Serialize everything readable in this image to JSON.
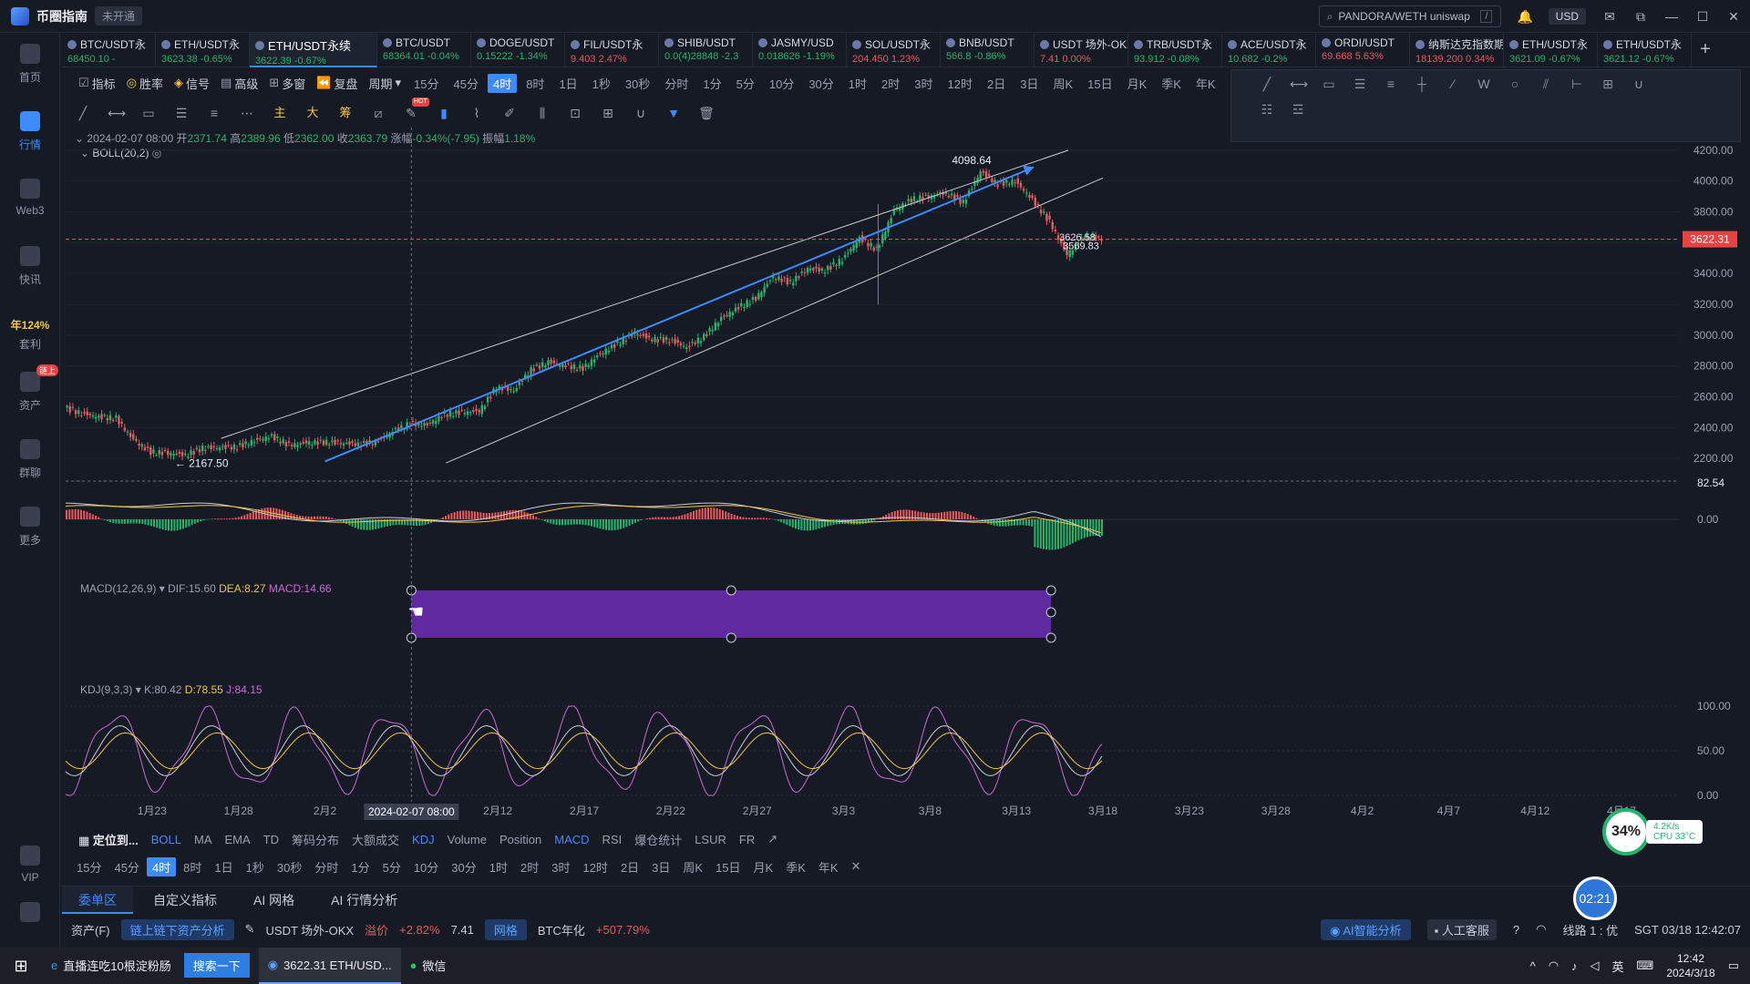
{
  "app": {
    "name": "币圈指南",
    "status": "未开通"
  },
  "titlebar": {
    "search_value": "PANDORA/WETH uniswap",
    "search_key": "/",
    "currency": "USD"
  },
  "sidebar": [
    {
      "label": "首页",
      "icon": "home-icon"
    },
    {
      "label": "行情",
      "icon": "chart-icon"
    },
    {
      "label": "Web3",
      "icon": "web3-icon"
    },
    {
      "label": "快讯",
      "icon": "news-icon"
    },
    {
      "pct": "年124%",
      "label": "套利",
      "icon": "arbitrage-icon"
    },
    {
      "label": "资产",
      "icon": "wallet-icon",
      "badge": "链上"
    },
    {
      "label": "群聊",
      "icon": "chat-icon"
    },
    {
      "label": "更多",
      "icon": "grid-icon"
    },
    {
      "label": "VIP",
      "icon": "vip-icon"
    },
    {
      "label": "",
      "icon": "settings-icon"
    }
  ],
  "tabs": [
    {
      "name": "BTC/USDT永",
      "sub": "68450.10 -",
      "dir": "down"
    },
    {
      "name": "ETH/USDT永",
      "sub": "3623.38 -0.65%",
      "dir": "down"
    },
    {
      "name": "ETH/USDT永续",
      "sub": "3622.39 -0.67%",
      "dir": "down",
      "active": true
    },
    {
      "name": "BTC/USDT",
      "sub": "68364.01 -0.04%",
      "dir": "down"
    },
    {
      "name": "DOGE/USDT",
      "sub": "0.15222 -1.34%",
      "dir": "down"
    },
    {
      "name": "FIL/USDT永",
      "sub": "9.403 2.47%",
      "dir": "up"
    },
    {
      "name": "SHIB/USDT",
      "sub": "0.0(4)28848 -2.3",
      "dir": "down"
    },
    {
      "name": "JASMY/USD",
      "sub": "0.018626 -1.19%",
      "dir": "down"
    },
    {
      "name": "SOL/USDT永",
      "sub": "204.450 1.23%",
      "dir": "up"
    },
    {
      "name": "BNB/USDT",
      "sub": "566.8 -0.86%",
      "dir": "down"
    },
    {
      "name": "USDT 场外-OKX",
      "sub": "7.41 0.00%",
      "dir": "up"
    },
    {
      "name": "TRB/USDT永",
      "sub": "93.912 -0.08%",
      "dir": "down"
    },
    {
      "name": "ACE/USDT永",
      "sub": "10.682 -0.2%",
      "dir": "down"
    },
    {
      "name": "ORDI/USDT",
      "sub": "69.668 5.63%",
      "dir": "up"
    },
    {
      "name": "纳斯达克指数期",
      "sub": "18139.200 0.34%",
      "dir": "up"
    },
    {
      "name": "ETH/USDT永",
      "sub": "3621.09 -0.67%",
      "dir": "down"
    },
    {
      "name": "ETH/USDT永",
      "sub": "3621.12 -0.67%",
      "dir": "down"
    }
  ],
  "toolbar1": {
    "items": [
      "指标",
      "胜率",
      "信号",
      "高级",
      "多窗",
      "复盘",
      "周期"
    ],
    "periods": [
      "15分",
      "45分",
      "4时",
      "8时",
      "1日",
      "1秒",
      "30秒",
      "分时",
      "1分",
      "5分",
      "10分",
      "30分",
      "1时",
      "2时",
      "3时",
      "12时",
      "2日",
      "3日",
      "周K",
      "15日",
      "月K",
      "季K",
      "年K"
    ],
    "active_period": "4时"
  },
  "toolbar2": {
    "gold_labels": [
      "主",
      "大",
      "筹"
    ],
    "hot": "HOT"
  },
  "ohlc": {
    "date": "2024-02-07 08:00",
    "open_label": "开",
    "open": "2371.74",
    "high_label": "高",
    "high": "2389.96",
    "low_label": "低",
    "low": "2362.00",
    "close_label": "收",
    "close": "2363.79",
    "chg_label": "涨幅",
    "chg": "-0.34%(-7.95)",
    "amp_label": "振幅",
    "amp": "1.18%"
  },
  "boll": "BOLL(20,2)",
  "macd": {
    "name": "MACD(12,26,9)",
    "dif": "DIF:15.60",
    "dea": "DEA:8.27",
    "macd": "MACD:14.66"
  },
  "kdj": {
    "name": "KDJ(9,3,3)",
    "k": "K:80.42",
    "d": "D:78.55",
    "j": "J:84.15"
  },
  "chart_data": {
    "type": "candlestick",
    "symbol": "ETH/USDT永续",
    "interval": "4时",
    "y_ticks": [
      4200,
      4000,
      3800,
      3600,
      3400,
      3200,
      3000,
      2800,
      2600,
      2400,
      2200
    ],
    "ylim": [
      2100,
      4300
    ],
    "x_ticks": [
      "1月23",
      "1月28",
      "2月2",
      "2月7",
      "2月12",
      "2月17",
      "2月22",
      "2月27",
      "3月3",
      "3月8",
      "3月13",
      "3月18",
      "3月23",
      "3月28",
      "4月2",
      "4月7",
      "4月12",
      "4月17"
    ],
    "xlim_dates": [
      "2024-01-18",
      "2024-04-20"
    ],
    "crosshair_date": "2024-02-07 08:00",
    "current_price": "3622.31",
    "annotations": {
      "high": "4098.64",
      "low": "2167.50",
      "mark1": "3626.58",
      "mark2": "3569.83"
    },
    "series": [
      {
        "date": "01-18",
        "close": 2530
      },
      {
        "date": "01-19",
        "close": 2490
      },
      {
        "date": "01-20",
        "close": 2470
      },
      {
        "date": "01-21",
        "close": 2460
      },
      {
        "date": "01-22",
        "close": 2320
      },
      {
        "date": "01-23",
        "close": 2240
      },
      {
        "date": "01-24",
        "close": 2235
      },
      {
        "date": "01-25",
        "close": 2220
      },
      {
        "date": "01-26",
        "close": 2265
      },
      {
        "date": "01-27",
        "close": 2270
      },
      {
        "date": "01-28",
        "close": 2275
      },
      {
        "date": "01-29",
        "close": 2315
      },
      {
        "date": "01-30",
        "close": 2345
      },
      {
        "date": "01-31",
        "close": 2285
      },
      {
        "date": "02-01",
        "close": 2300
      },
      {
        "date": "02-02",
        "close": 2305
      },
      {
        "date": "02-03",
        "close": 2300
      },
      {
        "date": "02-04",
        "close": 2290
      },
      {
        "date": "02-05",
        "close": 2305
      },
      {
        "date": "02-06",
        "close": 2375
      },
      {
        "date": "02-07",
        "close": 2425
      },
      {
        "date": "02-08",
        "close": 2420
      },
      {
        "date": "02-09",
        "close": 2485
      },
      {
        "date": "02-10",
        "close": 2500
      },
      {
        "date": "02-11",
        "close": 2505
      },
      {
        "date": "02-12",
        "close": 2660
      },
      {
        "date": "02-13",
        "close": 2640
      },
      {
        "date": "02-14",
        "close": 2775
      },
      {
        "date": "02-15",
        "close": 2825
      },
      {
        "date": "02-16",
        "close": 2800
      },
      {
        "date": "02-17",
        "close": 2785
      },
      {
        "date": "02-18",
        "close": 2880
      },
      {
        "date": "02-19",
        "close": 2945
      },
      {
        "date": "02-20",
        "close": 3015
      },
      {
        "date": "02-21",
        "close": 2970
      },
      {
        "date": "02-22",
        "close": 2970
      },
      {
        "date": "02-23",
        "close": 2920
      },
      {
        "date": "02-24",
        "close": 2990
      },
      {
        "date": "02-25",
        "close": 3110
      },
      {
        "date": "02-26",
        "close": 3180
      },
      {
        "date": "02-27",
        "close": 3240
      },
      {
        "date": "02-28",
        "close": 3380
      },
      {
        "date": "02-29",
        "close": 3340
      },
      {
        "date": "03-01",
        "close": 3430
      },
      {
        "date": "03-02",
        "close": 3420
      },
      {
        "date": "03-03",
        "close": 3490
      },
      {
        "date": "03-04",
        "close": 3630
      },
      {
        "date": "03-05",
        "close": 3555
      },
      {
        "date": "03-06",
        "close": 3810
      },
      {
        "date": "03-07",
        "close": 3880
      },
      {
        "date": "03-08",
        "close": 3900
      },
      {
        "date": "03-09",
        "close": 3920
      },
      {
        "date": "03-10",
        "close": 3860
      },
      {
        "date": "03-11",
        "close": 4060
      },
      {
        "date": "03-12",
        "close": 3980
      },
      {
        "date": "03-13",
        "close": 4000
      },
      {
        "date": "03-14",
        "close": 3880
      },
      {
        "date": "03-15",
        "close": 3735
      },
      {
        "date": "03-16",
        "close": 3520
      },
      {
        "date": "03-17",
        "close": 3640
      },
      {
        "date": "03-18",
        "close": 3622
      }
    ]
  },
  "macd_axis": [
    "82.54",
    "0.00"
  ],
  "kdj_axis": [
    "100.00",
    "50.00",
    "0.00"
  ],
  "ind_bar": {
    "locate": "定位到...",
    "items": [
      "BOLL",
      "MA",
      "EMA",
      "TD",
      "筹码分布",
      "大额成交",
      "KDJ",
      "Volume",
      "Position",
      "MACD",
      "RSI",
      "爆仓统计",
      "LSUR",
      "FR"
    ],
    "active": [
      "BOLL",
      "KDJ",
      "MACD"
    ]
  },
  "period_bar": [
    "15分",
    "45分",
    "4时",
    "8时",
    "1日",
    "1秒",
    "30秒",
    "分时",
    "1分",
    "5分",
    "10分",
    "30分",
    "1时",
    "2时",
    "3时",
    "12时",
    "2日",
    "3日",
    "周K",
    "15日",
    "月K",
    "季K",
    "年K"
  ],
  "bottom_tabs": [
    "委单区",
    "自定义指标",
    "AI 网格",
    "AI 行情分析"
  ],
  "statusbar": {
    "assets": "资产(F)",
    "chip": "链上链下资产分析",
    "otc": "USDT 场外-OKX",
    "premium_label": "溢价",
    "premium": "+2.82%",
    "otc_price": "7.41",
    "grid": "网格",
    "btc_annual_label": "BTC年化",
    "btc_annual": "+507.79%",
    "ai": "AI智能分析",
    "service": "人工客服",
    "line": "线路 1 : 优",
    "time": "SGT 03/18 12:42:07"
  },
  "perf": {
    "pct": "34%",
    "net": "4.2K/s",
    "cpu": "CPU 33°C"
  },
  "timer": "02:21",
  "taskbar": {
    "browser": "直播连吃10根淀粉肠",
    "search_btn": "搜索一下",
    "app": "3622.31 ETH/USD...",
    "wechat": "微信",
    "ime": "英",
    "time": "12:42",
    "date": "2024/3/18"
  },
  "colors": {
    "up": "#27b36b",
    "down": "#e45b5b",
    "accent": "#3d8bff",
    "bg": "#161a25"
  }
}
